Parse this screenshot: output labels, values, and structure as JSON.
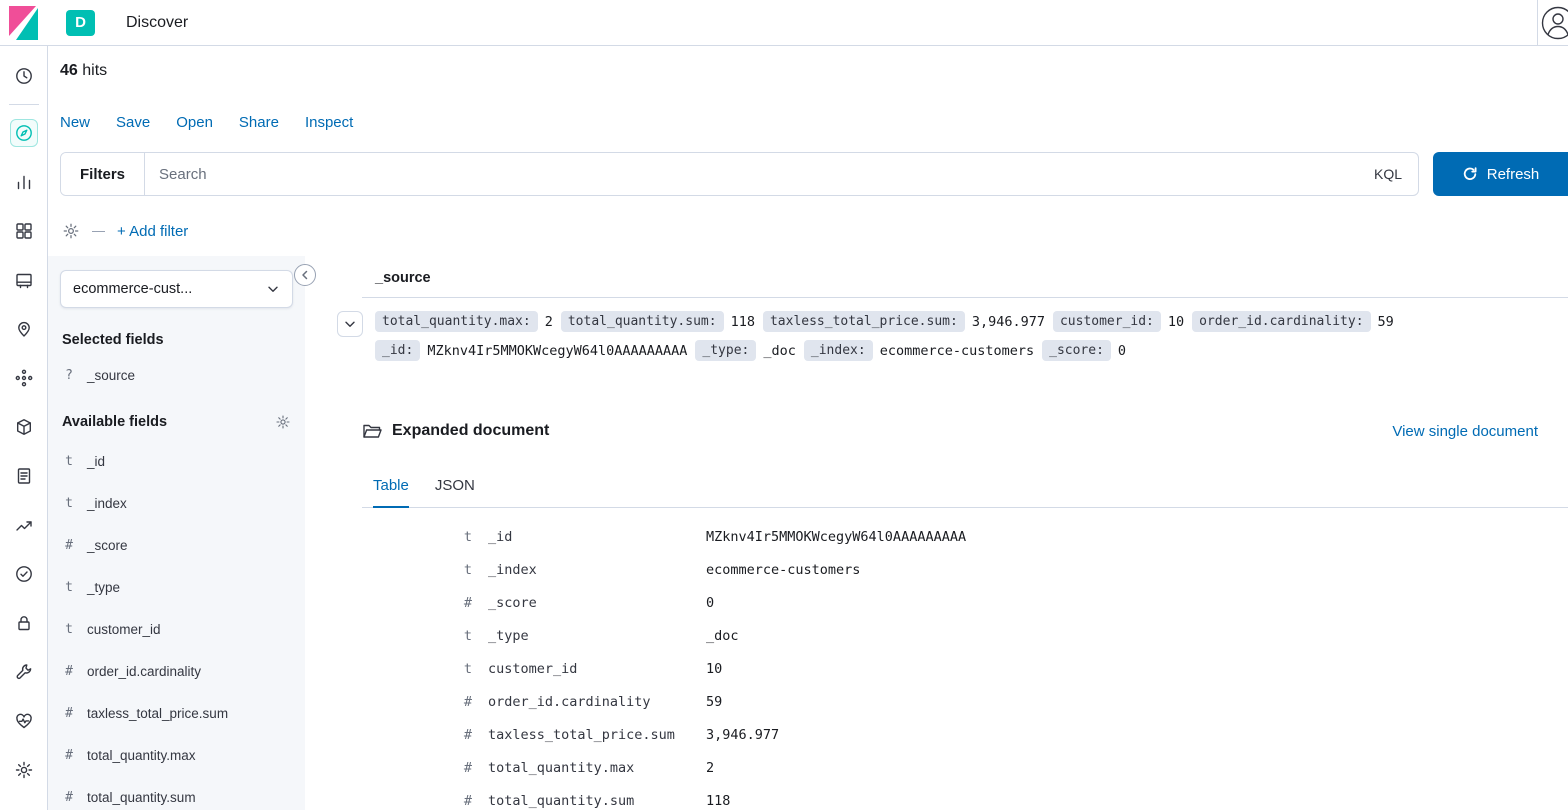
{
  "header": {
    "app_badge": "D",
    "title": "Discover"
  },
  "nav_rail": {
    "items": [
      "recent",
      "discover",
      "visualize",
      "dashboard",
      "canvas",
      "maps",
      "machine-learning",
      "apm",
      "logs",
      "metrics",
      "uptime",
      "siem",
      "dev-tools",
      "monitoring",
      "management"
    ],
    "active": "discover"
  },
  "hits": {
    "count": "46",
    "label": "hits"
  },
  "top_menu": {
    "items": [
      "New",
      "Save",
      "Open",
      "Share",
      "Inspect"
    ]
  },
  "query_bar": {
    "filters_label": "Filters",
    "search_placeholder": "Search",
    "language": "KQL",
    "refresh_label": "Refresh"
  },
  "filter_bar": {
    "add_filter_label": "+ Add filter"
  },
  "fields_panel": {
    "index_pattern": "ecommerce-cust...",
    "selected_title": "Selected fields",
    "selected_fields": [
      {
        "type": "?",
        "name": "_source"
      }
    ],
    "available_title": "Available fields",
    "available_fields": [
      {
        "type": "t",
        "name": "_id"
      },
      {
        "type": "t",
        "name": "_index"
      },
      {
        "type": "#",
        "name": "_score"
      },
      {
        "type": "t",
        "name": "_type"
      },
      {
        "type": "t",
        "name": "customer_id"
      },
      {
        "type": "#",
        "name": "order_id.cardinality"
      },
      {
        "type": "#",
        "name": "taxless_total_price.sum"
      },
      {
        "type": "#",
        "name": "total_quantity.max"
      },
      {
        "type": "#",
        "name": "total_quantity.sum"
      }
    ]
  },
  "results": {
    "column_header": "_source",
    "document_badges": [
      {
        "key": "total_quantity.max:",
        "value": "2"
      },
      {
        "key": "total_quantity.sum:",
        "value": "118"
      },
      {
        "key": "taxless_total_price.sum:",
        "value": "3,946.977"
      },
      {
        "key": "customer_id:",
        "value": "10"
      },
      {
        "key": "order_id.cardinality:",
        "value": "59"
      },
      {
        "key": "_id:",
        "value": "MZknv4Ir5MMOKWcegyW64l0AAAAAAAAA"
      },
      {
        "key": "_type:",
        "value": "_doc"
      },
      {
        "key": "_index:",
        "value": "ecommerce-customers"
      },
      {
        "key": "_score:",
        "value": "0"
      }
    ],
    "expanded": {
      "title": "Expanded document",
      "action_label": "View single document",
      "tabs": [
        {
          "label": "Table"
        },
        {
          "label": "JSON"
        }
      ],
      "rows": [
        {
          "type": "t",
          "field": "_id",
          "value": "MZknv4Ir5MMOKWcegyW64l0AAAAAAAAA"
        },
        {
          "type": "t",
          "field": "_index",
          "value": "ecommerce-customers"
        },
        {
          "type": "#",
          "field": "_score",
          "value": "0"
        },
        {
          "type": "t",
          "field": "_type",
          "value": "_doc"
        },
        {
          "type": "t",
          "field": "customer_id",
          "value": "10"
        },
        {
          "type": "#",
          "field": "order_id.cardinality",
          "value": "59"
        },
        {
          "type": "#",
          "field": "taxless_total_price.sum",
          "value": "3,946.977"
        },
        {
          "type": "#",
          "field": "total_quantity.max",
          "value": "2"
        },
        {
          "type": "#",
          "field": "total_quantity.sum",
          "value": "118"
        }
      ]
    }
  }
}
